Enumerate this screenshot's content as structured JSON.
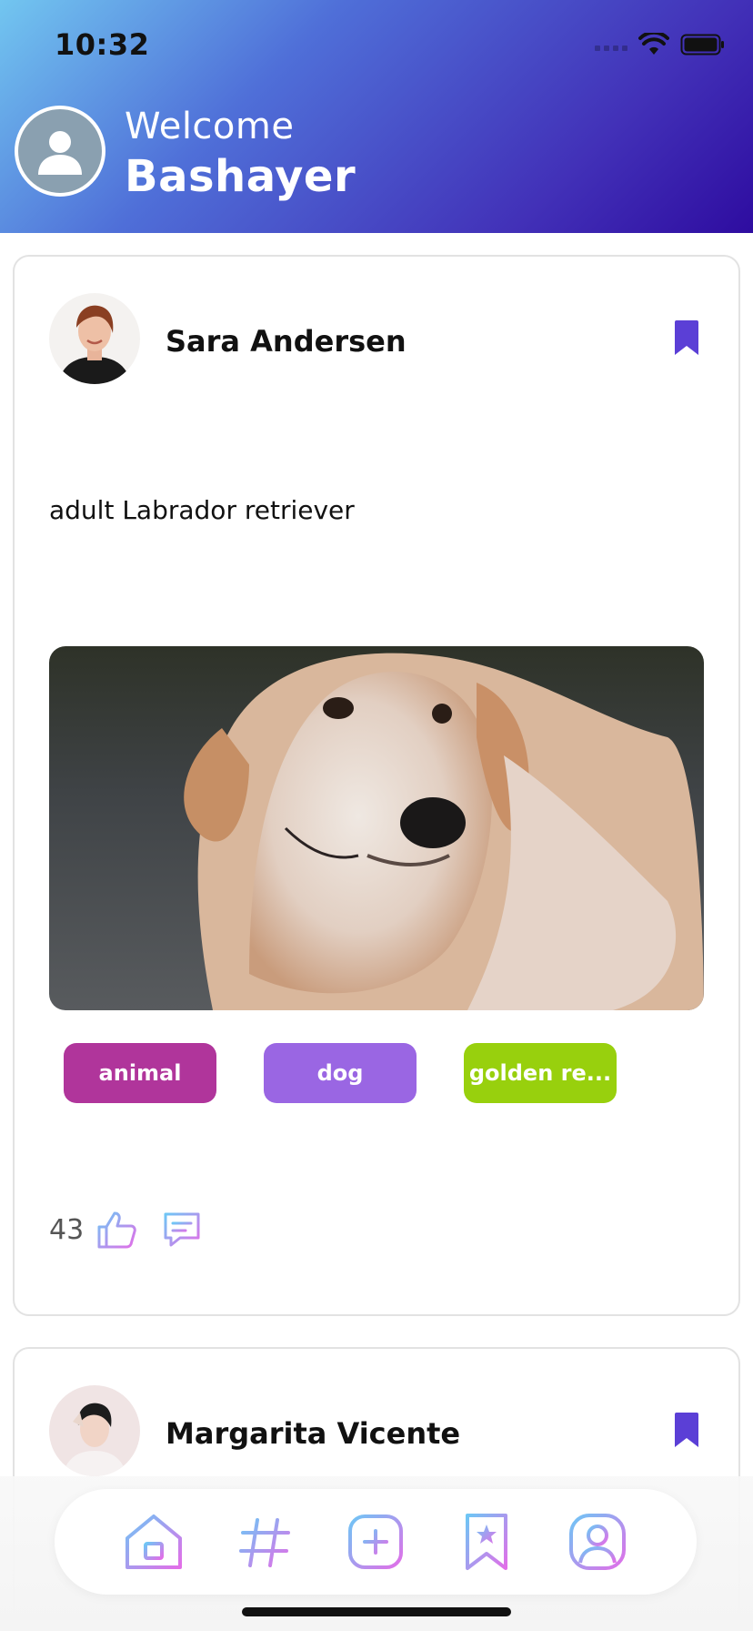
{
  "status_bar": {
    "time": "10:32"
  },
  "header": {
    "welcome": "Welcome",
    "username": "Bashayer"
  },
  "posts": [
    {
      "author": "Sara Andersen",
      "text": "adult Labrador retriever",
      "tags": [
        {
          "label": "animal",
          "color": "#b0359b"
        },
        {
          "label": "dog",
          "color": "#9a66e3"
        },
        {
          "label": "golden re...",
          "color": "#98d00d"
        }
      ],
      "likes": "43"
    },
    {
      "author": "Margarita Vicente"
    }
  ],
  "colors": {
    "accent": "#5b3fd6",
    "nav_gradient_start": "#6ec6f5",
    "nav_gradient_end": "#e26ee8"
  },
  "icons": [
    "person-icon",
    "bookmark-icon",
    "like-icon",
    "comment-icon",
    "home-icon",
    "hashtag-icon",
    "add-icon",
    "saved-icon",
    "profile-icon"
  ]
}
